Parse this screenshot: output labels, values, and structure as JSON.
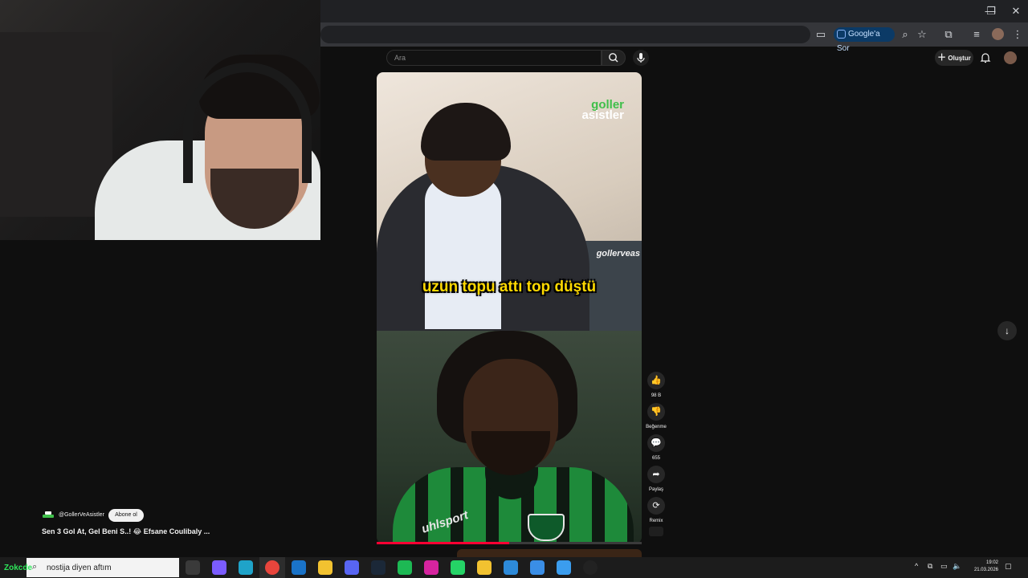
{
  "browser": {
    "window_controls": {
      "minimize": "—",
      "restore": "❐",
      "close": "✕"
    },
    "google_sor_label": "Google'a Sor"
  },
  "youtube": {
    "search": {
      "placeholder": "Ara"
    },
    "create_label": "Oluştur",
    "short": {
      "logo_line1": "goller",
      "logo_line2": "asistler",
      "watermark": "gollerveas",
      "caption": "uzun topu attı top düştü",
      "jersey_brand": "uhlsport",
      "progress_fraction": 0.5
    },
    "actions": {
      "like_count": "98 B",
      "dislike_label": "Beğenme",
      "comment_count": "655",
      "share_label": "Paylaş",
      "remix_label": "Remix"
    },
    "channel": {
      "handle": "@GollerVeAsistler",
      "subscribe_label": "Abone ol",
      "video_title": "Sen 3 Gol At, Gel Beni S..! 😂 Efsane Coulibaly ..."
    }
  },
  "taskbar": {
    "chat_overlay_text": "Zokcde",
    "search_text": "nostija diyen aftım",
    "time": "19:02",
    "date": "21.03.2026",
    "apps": [
      {
        "name": "task-view-icon",
        "color": "#3a3a3a"
      },
      {
        "name": "copilot-icon",
        "color": "#7b5cff"
      },
      {
        "name": "edge-icon",
        "color": "#1fa3c9"
      },
      {
        "name": "chrome-icon",
        "color": "#e8453c"
      },
      {
        "name": "outlook-icon",
        "color": "#1a73c8"
      },
      {
        "name": "file-explorer-icon",
        "color": "#f2c230"
      },
      {
        "name": "discord-icon",
        "color": "#5865f2"
      },
      {
        "name": "steam-icon",
        "color": "#1b2838"
      },
      {
        "name": "spotify-icon",
        "color": "#1db954"
      },
      {
        "name": "instagram-icon",
        "color": "#d6249f"
      },
      {
        "name": "whatsapp-icon",
        "color": "#25d366"
      },
      {
        "name": "document-icon",
        "color": "#f2c230"
      },
      {
        "name": "vscode-icon",
        "color": "#2d8ad9"
      },
      {
        "name": "arrow-app-icon",
        "color": "#3a8ee6"
      },
      {
        "name": "paint-icon",
        "color": "#3b9dee"
      },
      {
        "name": "obs-icon",
        "color": "#222222"
      }
    ]
  }
}
